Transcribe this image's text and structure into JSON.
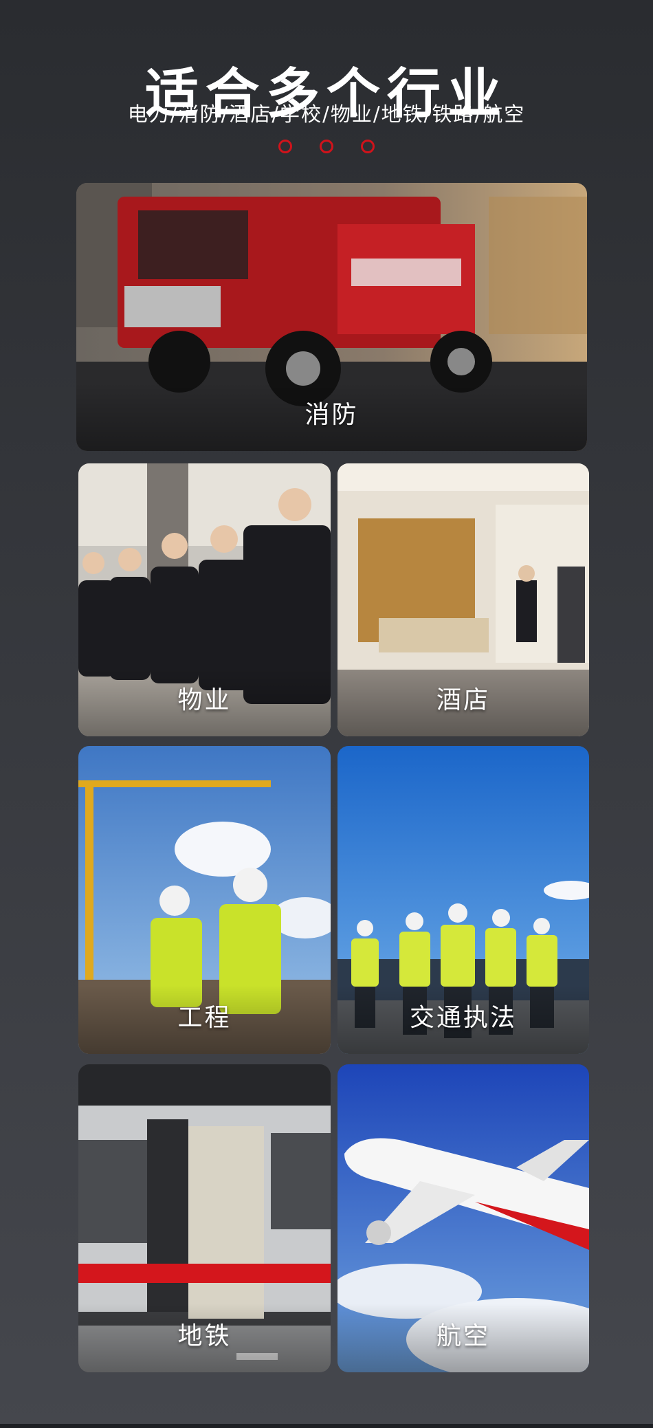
{
  "header": {
    "title": "适合多个行业",
    "subtitle": "电力/消防/酒店/学校/物业/地铁/铁路/航空"
  },
  "colors": {
    "accent": "#d0131b",
    "background_top": "#2a2c30",
    "background_bottom": "#45474d"
  },
  "cards": [
    {
      "label": "消防",
      "scene": "fire-truck-image"
    },
    {
      "label": "物业",
      "scene": "property-staff-image"
    },
    {
      "label": "酒店",
      "scene": "hotel-lobby-image"
    },
    {
      "label": "工程",
      "scene": "construction-workers-image"
    },
    {
      "label": "交通执法",
      "scene": "traffic-police-image"
    },
    {
      "label": "地铁",
      "scene": "subway-train-image"
    },
    {
      "label": "航空",
      "scene": "airplane-image"
    }
  ]
}
